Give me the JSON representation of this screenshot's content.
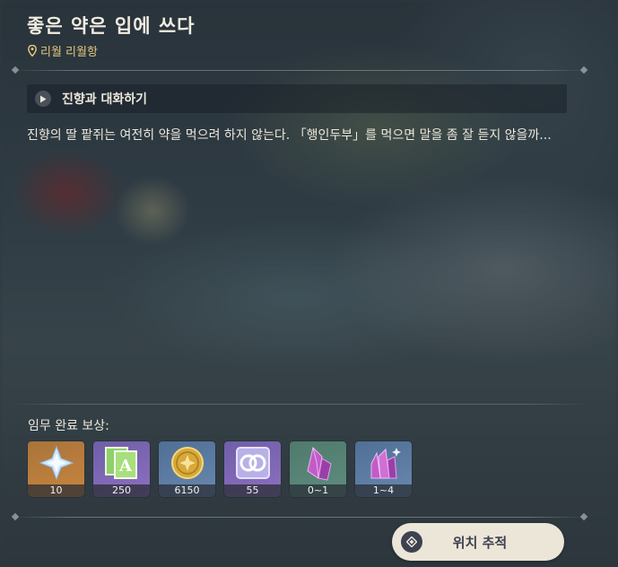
{
  "quest": {
    "title": "좋은 약은 입에 쓰다",
    "location": "리월 리월항",
    "objective": "진향과 대화하기",
    "description": "진향의 딸 팥쥐는 여전히 약을 먹으려 하지 않는다. 「행인두부」를 먹으면 말을 좀 잘 듣지 않을까..."
  },
  "rewards": {
    "label": "임무 완료 보상:",
    "items": [
      {
        "icon": "primogem-icon",
        "count": "10",
        "color": "#c9853e"
      },
      {
        "icon": "adventure-exp-icon",
        "count": "250",
        "color": "#8d6fc0"
      },
      {
        "icon": "mora-icon",
        "count": "6150",
        "color": "#6a88ae"
      },
      {
        "icon": "companionship-exp-icon",
        "count": "55",
        "color": "#8d6fc0"
      },
      {
        "icon": "crystal-chunk-icon",
        "count": "0~1",
        "color": "#5f8d7f"
      },
      {
        "icon": "crystal-cluster-icon",
        "count": "1~4",
        "color": "#6a88ae"
      }
    ]
  },
  "actions": {
    "track_label": "위치 추적"
  }
}
